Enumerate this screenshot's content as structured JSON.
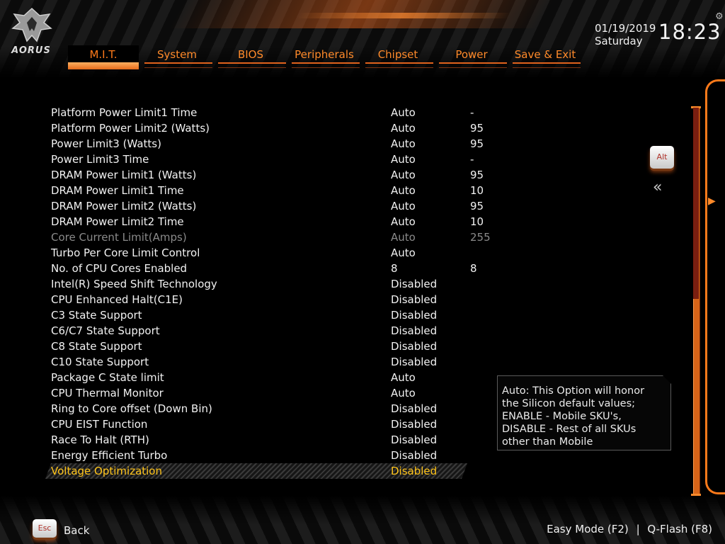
{
  "header": {
    "brand": "AORUS",
    "date": "01/19/2019",
    "weekday": "Saturday",
    "time": "18:23",
    "tabs": [
      {
        "label": "M.I.T.",
        "active": true
      },
      {
        "label": "System",
        "active": false
      },
      {
        "label": "BIOS",
        "active": false
      },
      {
        "label": "Peripherals",
        "active": false
      },
      {
        "label": "Chipset",
        "active": false
      },
      {
        "label": "Power",
        "active": false
      },
      {
        "label": "Save & Exit",
        "active": false
      }
    ]
  },
  "settings": [
    {
      "label": "Platform Power Limit1 Time",
      "value": "Auto",
      "current": "-"
    },
    {
      "label": "Platform Power Limit2 (Watts)",
      "value": "Auto",
      "current": "95"
    },
    {
      "label": "Power Limit3 (Watts)",
      "value": "Auto",
      "current": "95"
    },
    {
      "label": "Power Limit3 Time",
      "value": "Auto",
      "current": "-"
    },
    {
      "label": "DRAM Power Limit1 (Watts)",
      "value": "Auto",
      "current": "95"
    },
    {
      "label": "DRAM Power Limit1 Time",
      "value": "Auto",
      "current": "10"
    },
    {
      "label": "DRAM Power Limit2 (Watts)",
      "value": "Auto",
      "current": "95"
    },
    {
      "label": "DRAM Power Limit2 Time",
      "value": "Auto",
      "current": "10"
    },
    {
      "label": "Core Current Limit(Amps)",
      "value": "Auto",
      "current": "255",
      "disabled": true
    },
    {
      "label": "Turbo Per Core Limit Control",
      "value": "Auto",
      "current": ""
    },
    {
      "label": "No. of CPU Cores Enabled",
      "value": "8",
      "current": "8"
    },
    {
      "label": "Intel(R) Speed Shift Technology",
      "value": "Disabled",
      "current": ""
    },
    {
      "label": "CPU Enhanced Halt(C1E)",
      "value": "Disabled",
      "current": ""
    },
    {
      "label": "C3 State Support",
      "value": "Disabled",
      "current": ""
    },
    {
      "label": "C6/C7 State Support",
      "value": "Disabled",
      "current": ""
    },
    {
      "label": "C8 State Support",
      "value": "Disabled",
      "current": ""
    },
    {
      "label": "C10 State Support",
      "value": "Disabled",
      "current": ""
    },
    {
      "label": "Package C State limit",
      "value": "Auto",
      "current": ""
    },
    {
      "label": "CPU Thermal Monitor",
      "value": "Auto",
      "current": ""
    },
    {
      "label": "Ring to Core offset (Down Bin)",
      "value": "Disabled",
      "current": ""
    },
    {
      "label": "CPU EIST Function",
      "value": "Disabled",
      "current": ""
    },
    {
      "label": "Race To Halt (RTH)",
      "value": "Disabled",
      "current": ""
    },
    {
      "label": "Energy Efficient Turbo",
      "value": "Disabled",
      "current": ""
    },
    {
      "label": "Voltage Optimization",
      "value": "Disabled",
      "current": "",
      "selected": true
    }
  ],
  "help": {
    "lines": [
      "Auto: This Option will honor",
      "the Silicon default values;",
      "ENABLE - Mobile SKU's,",
      "DISABLE - Rest of all SKUs",
      "other than Mobile"
    ]
  },
  "side": {
    "alt_label": "Alt",
    "collapse_glyph": "«"
  },
  "footer": {
    "esc_label": "Esc",
    "back_label": "Back",
    "easy_mode_label": "Easy Mode (F2)",
    "separator": "|",
    "qflash_label": "Q-Flash (F8)"
  },
  "colors": {
    "accent": "#ff7a1a",
    "selected_text": "#ffc41a",
    "disabled_text": "#8a8a8a"
  }
}
